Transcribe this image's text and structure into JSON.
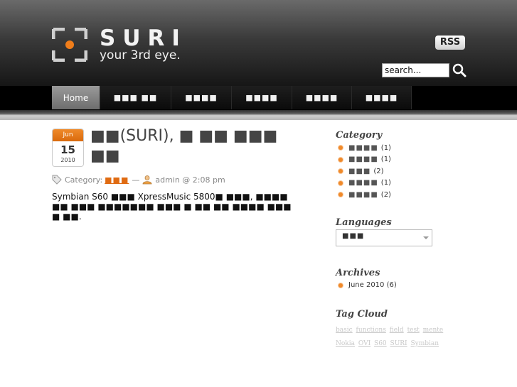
{
  "brand": {
    "name": "SURI",
    "tagline": "your 3rd eye."
  },
  "header": {
    "rss_label": "RSS",
    "search_value": "search..."
  },
  "nav": {
    "items": [
      "Home",
      "■■■ ■■",
      "■■■■",
      "■■■■",
      "■■■■",
      "■■■■"
    ]
  },
  "post": {
    "date": {
      "month": "Jun",
      "day": "15",
      "year": "2010"
    },
    "title": "■■(SURI), ■ ■■ ■■■ ■■",
    "meta": {
      "category_prefix": "Category:",
      "category_link": "■■■",
      "dash": "—",
      "author_time": "admin @ 2:08 pm"
    },
    "body": "Symbian S60 ■■■ XpressMusic 5800■ ■■■, ■■■■■■ ■■■ ■■■■■■■ ■■■ ■ ■■ ■■ ■■■■ ■■■■ ■■."
  },
  "sidebar": {
    "category": {
      "title": "Category",
      "items": [
        {
          "label": "■■■■",
          "count": "(1)"
        },
        {
          "label": "■■■■",
          "count": "(1)"
        },
        {
          "label": "■■■",
          "count": "(2)"
        },
        {
          "label": "■■■■",
          "count": "(1)"
        },
        {
          "label": "■■■■",
          "count": "(2)"
        }
      ]
    },
    "languages": {
      "title": "Languages",
      "selected": "■■■"
    },
    "archives": {
      "title": "Archives",
      "items": [
        "June 2010 (6)"
      ]
    },
    "tag_cloud": {
      "title": "Tag Cloud",
      "tags": [
        "basic",
        "functions",
        "field",
        "test",
        "mente",
        "Nokia",
        "OVI",
        "S60",
        "SURI",
        "Symbian"
      ]
    }
  },
  "colors": {
    "accent": "#e06b12",
    "bullet": "#f08a2a",
    "header_dark": "#161616"
  }
}
